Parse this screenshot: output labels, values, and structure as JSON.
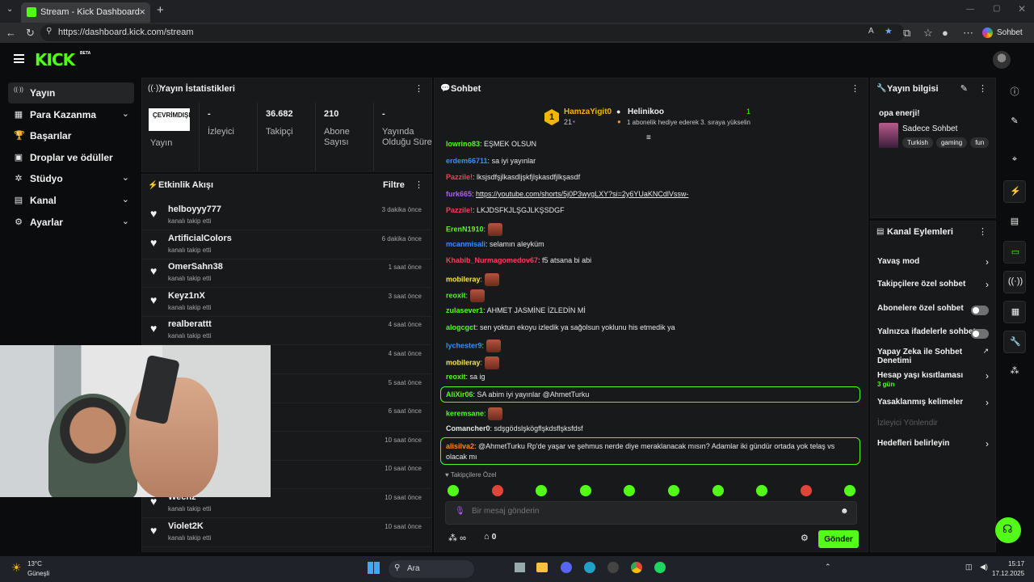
{
  "browser": {
    "tab_title": "Stream - Kick Dashboard",
    "url": "https://dashboard.kick.com/stream",
    "sohbet_button": "Sohbet et"
  },
  "app": {
    "logo": "KICK",
    "beta": "BETA"
  },
  "sidebar": {
    "items": [
      {
        "label": "Yayın",
        "icon": "broadcast-icon",
        "glyph": "((·))"
      },
      {
        "label": "Para Kazanma",
        "icon": "money-icon",
        "glyph": "▦"
      },
      {
        "label": "Başarılar",
        "icon": "trophy-icon",
        "glyph": "🏆"
      },
      {
        "label": "Droplar ve ödüller",
        "icon": "gift-icon",
        "glyph": "▣"
      },
      {
        "label": "Stüdyo",
        "icon": "studio-icon",
        "glyph": "✲"
      },
      {
        "label": "Kanal",
        "icon": "channel-icon",
        "glyph": "▤"
      },
      {
        "label": "Ayarlar",
        "icon": "settings-icon",
        "glyph": "⚙"
      }
    ]
  },
  "stats": {
    "title": "Yayın İstatistikleri",
    "live_status": "ÇEVRİMDIŞI",
    "live_label": "Yayın",
    "cells": [
      {
        "value": "-",
        "label": "İzleyici"
      },
      {
        "value": "36.682",
        "label": "Takipçi"
      },
      {
        "value": "210",
        "label": "Abone Sayısı"
      },
      {
        "value": "-",
        "label": "Yayında Olduğu Süre"
      }
    ]
  },
  "activity": {
    "title": "Etkinlik Akışı",
    "filter": "Filtre",
    "rows": [
      {
        "name": "helboyyy777",
        "sub": "kanalı takip etti",
        "time": "3 dakika önce"
      },
      {
        "name": "ArtificialColors",
        "sub": "kanalı takip etti",
        "time": "6 dakika önce"
      },
      {
        "name": "OmerSahn38",
        "sub": "kanalı takip etti",
        "time": "1 saat önce"
      },
      {
        "name": "Keyz1nX",
        "sub": "kanalı takip etti",
        "time": "3 saat önce"
      },
      {
        "name": "realberattt",
        "sub": "kanalı takip etti",
        "time": "4 saat önce"
      },
      {
        "name": "",
        "sub": "",
        "time": "4 saat önce"
      },
      {
        "name": "",
        "sub": "",
        "time": "5 saat önce"
      },
      {
        "name": "",
        "sub": "",
        "time": "6 saat önce"
      },
      {
        "name": "",
        "sub": "",
        "time": "10 saat önce"
      },
      {
        "name": "",
        "sub": "",
        "time": "10 saat önce"
      },
      {
        "name": "Wechz",
        "sub": "kanalı takip etti",
        "time": "10 saat önce"
      },
      {
        "name": "Violet2K",
        "sub": "kanalı takip etti",
        "time": "10 saat önce"
      }
    ]
  },
  "chat": {
    "title": "Sohbet",
    "pinned": {
      "rank": "1",
      "user": "HamzaYigit0",
      "count": "21",
      "gifter": "Helinikoo",
      "gifter_count": "1",
      "gifter_text": "1 abonelik hediye ederek 3. sıraya yükselin"
    },
    "messages": [
      {
        "user": "lowrino83",
        "color": "#53fc18",
        "text": "EŞMEK OLSUN",
        "emote": false
      },
      {
        "user": "erdem66711",
        "color": "#3a8dff",
        "text": "sa iyi yayınlar",
        "emote": false
      },
      {
        "user": "Pazzile!",
        "color": "#ff3b5c",
        "text": "lksjsdfşjlkasdljşkfjlşkasdfjlkşasdf",
        "emote": false
      },
      {
        "user": "furk665",
        "color": "#b05cff",
        "text": "https://youtube.com/shorts/5j0P3wygLXY?si=2y6YUaKNCdlVssw-",
        "emote": false
      },
      {
        "user": "Pazzile!",
        "color": "#ff3b5c",
        "text": "LKJDSFKJLŞGJLKŞSDGF",
        "emote": false
      },
      {
        "user": "ErenN1910",
        "color": "#53fc18",
        "text": "",
        "emote": true
      },
      {
        "user": "mcanmisali",
        "color": "#3a8dff",
        "text": "selamın aleyküm",
        "emote": false
      },
      {
        "user": "Khabib_Nurmagomedov67",
        "color": "#ff3b5c",
        "text": "f5 atsana bi abi",
        "emote": false
      },
      {
        "user": "mobileray",
        "color": "#f7e34f",
        "text": "",
        "emote": true
      },
      {
        "user": "reoxit",
        "color": "#53fc18",
        "text": "",
        "emote": true
      },
      {
        "user": "zulasever1",
        "color": "#53fc18",
        "text": "AHMET JASMİNE İZLEDİN Mİ",
        "emote": false
      },
      {
        "user": "alogcgct",
        "color": "#53fc18",
        "text": "sen yoktun ekoyu izledik ya sağolsun yoklunu his etmedik ya",
        "emote": false
      },
      {
        "user": "lychester9",
        "color": "#3a8dff",
        "text": "",
        "emote": true
      },
      {
        "user": "mobileray",
        "color": "#f7e34f",
        "text": "",
        "emote": true
      },
      {
        "user": "reoxit",
        "color": "#53fc18",
        "text": "sa ig",
        "emote": false
      }
    ],
    "highlight1": {
      "user": "AliXir06",
      "text": "SA abim iyi yayınlar @AhmetTurku"
    },
    "after": [
      {
        "user": "keremsane",
        "color": "#53fc18",
        "text": "",
        "emote": true
      },
      {
        "user": "Comancher0",
        "color": "#e8e8e8",
        "text": "sdşgödslşkögflşkdsflşksfdsf",
        "emote": false
      }
    ],
    "highlight2": {
      "user": "alisilva2",
      "text": "@AhmetTurku Rp'de yaşar ve şehmus nerde diye meraklanacak mısın? Adamlar iki gündür ortada yok telaş vs olacak mı"
    },
    "followers_only": "Takipçilere Özel",
    "input_placeholder": "Bir mesaj gönderin",
    "points": "∞",
    "store_count": "0",
    "send": "Gönder"
  },
  "stream_info": {
    "title": "Yayın bilgisi",
    "stream_title": "opa enerji!",
    "category": "Sadece Sohbet",
    "tags": [
      "Turkish",
      "gaming",
      "fun"
    ]
  },
  "channel_actions": {
    "title": "Kanal Eylemleri",
    "rows": [
      {
        "label": "Yavaş mod",
        "control": "chevron"
      },
      {
        "label": "Takipçilere özel sohbet",
        "control": "chevron"
      },
      {
        "label": "Abonelere özel sohbet",
        "control": "toggle"
      },
      {
        "label": "Yalnızca ifadelerle sohbet",
        "control": "toggle"
      },
      {
        "label": "Yapay Zeka ile Sohbet Denetimi",
        "control": "external"
      },
      {
        "label": "Hesap yaşı kısıtlaması",
        "control": "chevron",
        "sub": "3 gün"
      },
      {
        "label": "Yasaklanmış kelimeler",
        "control": "chevron"
      },
      {
        "label": "İzleyici Yönlendir",
        "control": "disabled"
      },
      {
        "label": "Hedefleri belirleyin",
        "control": "chevron"
      }
    ]
  },
  "taskbar": {
    "weather_temp": "13°C",
    "weather_desc": "Güneşli",
    "search": "Ara",
    "time": "15:17",
    "date": "17.12.2025"
  },
  "colors": {
    "accent": "#53fc18",
    "bg": "#0b0c0d",
    "panel": "#18191b"
  }
}
